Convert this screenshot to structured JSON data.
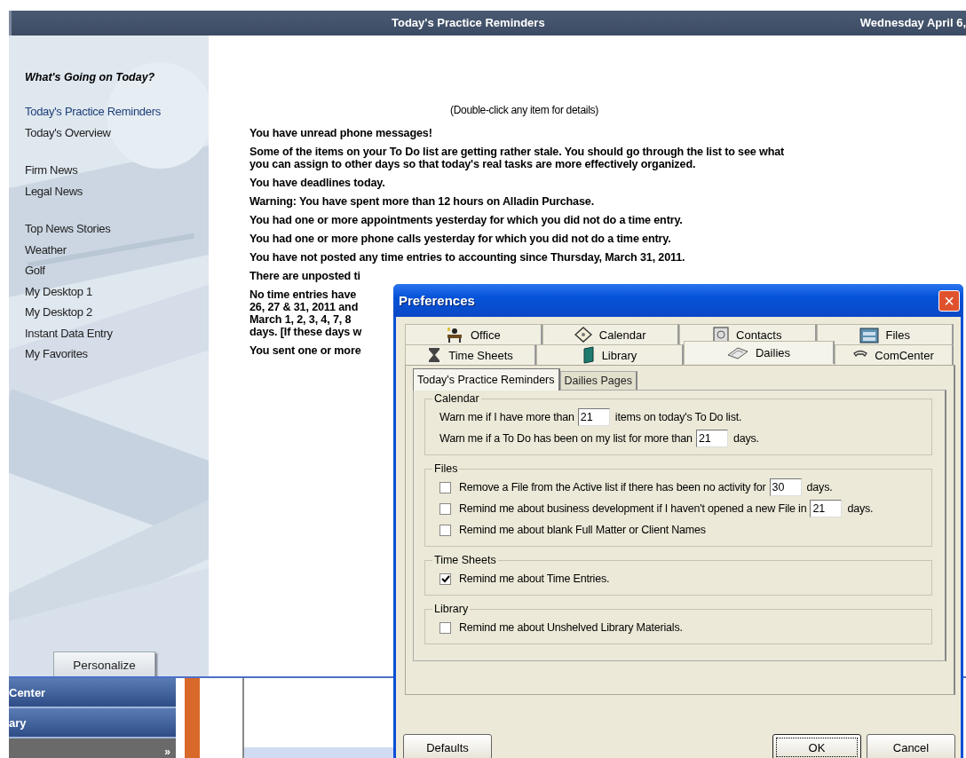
{
  "header": {
    "title": "Today's Practice Reminders",
    "date": "Wednesday April 6,"
  },
  "sidebar": {
    "heading": "What's Going on Today?",
    "groups": [
      [
        {
          "label": "Today's Practice Reminders",
          "selected": true
        },
        {
          "label": "Today's Overview",
          "selected": false
        }
      ],
      [
        {
          "label": "Firm News",
          "selected": false
        },
        {
          "label": "Legal News",
          "selected": false
        }
      ],
      [
        {
          "label": "Top News Stories",
          "selected": false
        },
        {
          "label": "Weather",
          "selected": false
        },
        {
          "label": "Golf",
          "selected": false
        },
        {
          "label": "My Desktop 1",
          "selected": false
        },
        {
          "label": "My Desktop 2",
          "selected": false
        },
        {
          "label": "Instant Data Entry",
          "selected": false
        },
        {
          "label": "My Favorites",
          "selected": false
        }
      ]
    ],
    "button": "Personalize"
  },
  "hint": "(Double-click any item for details)",
  "reminders": [
    {
      "lines": [
        "You have unread phone messages!"
      ]
    },
    {
      "lines": [
        "Some of the items on your To Do list are getting rather stale.  You should go through the list to see what",
        "you can assign to other days so that today's real tasks are more effectively organized."
      ]
    },
    {
      "lines": [
        "You have deadlines today."
      ]
    },
    {
      "lines": [
        "Warning:  You have spent more than 12 hours on Alladin Purchase."
      ]
    },
    {
      "lines": [
        "You had one or more appointments yesterday for which you did not do a time entry."
      ]
    },
    {
      "lines": [
        "You had one or more phone calls yesterday for which you did not do a time entry."
      ]
    },
    {
      "lines": [
        "You have not posted any time entries to accounting since Thursday, March 31, 2011."
      ]
    },
    {
      "lines": [
        "There are unposted ti"
      ]
    },
    {
      "lines": [
        "No time entries have",
        "26, 27 & 31, 2011 and",
        "March 1, 2, 3, 4, 7, 8",
        "days. [If these days w"
      ]
    },
    {
      "lines": [
        "You sent one or more"
      ]
    }
  ],
  "nav": {
    "items": [
      "Center",
      "ary"
    ],
    "more": "»"
  },
  "dialog": {
    "title": "Preferences",
    "close": "×",
    "tab_rows": [
      [
        {
          "label": "Office",
          "selected": false
        },
        {
          "label": "Calendar",
          "selected": false
        },
        {
          "label": "Contacts",
          "selected": false
        },
        {
          "label": "Files",
          "selected": false
        }
      ],
      [
        {
          "label": "Time Sheets",
          "selected": false
        },
        {
          "label": "Library",
          "selected": false
        },
        {
          "label": "Dailies",
          "selected": true
        },
        {
          "label": "ComCenter",
          "selected": false
        }
      ]
    ],
    "subtabs": [
      {
        "label": "Today's Practice Reminders",
        "selected": true
      },
      {
        "label": "Dailies Pages",
        "selected": false
      }
    ],
    "groups": [
      {
        "title": "Calendar",
        "rows": [
          {
            "kind": "field",
            "label": "Warn me if I have more than",
            "value": "21",
            "suffix": "items on today's To Do list."
          },
          {
            "kind": "field",
            "label": "Warn me if a To Do has been on my list for more than",
            "value": "21",
            "suffix": "days."
          }
        ]
      },
      {
        "title": "Files",
        "rows": [
          {
            "kind": "check-field",
            "checked": false,
            "label": "Remove a File from the Active list if there has been no activity for",
            "value": "30",
            "suffix": "days."
          },
          {
            "kind": "check-field",
            "checked": false,
            "label": "Remind me about business development if I haven't opened a new File in",
            "value": "21",
            "suffix": "days."
          },
          {
            "kind": "check",
            "checked": false,
            "label": "Remind me about blank Full Matter or Client Names"
          }
        ]
      },
      {
        "title": "Time Sheets",
        "rows": [
          {
            "kind": "check",
            "checked": true,
            "label": "Remind me about Time Entries."
          }
        ]
      },
      {
        "title": "Library",
        "rows": [
          {
            "kind": "check",
            "checked": false,
            "label": "Remind me about Unshelved Library Materials."
          }
        ]
      }
    ],
    "buttons": [
      {
        "label": "Defaults",
        "focused": false
      },
      {
        "label": "OK",
        "focused": true
      },
      {
        "label": "Cancel",
        "focused": false
      }
    ]
  }
}
